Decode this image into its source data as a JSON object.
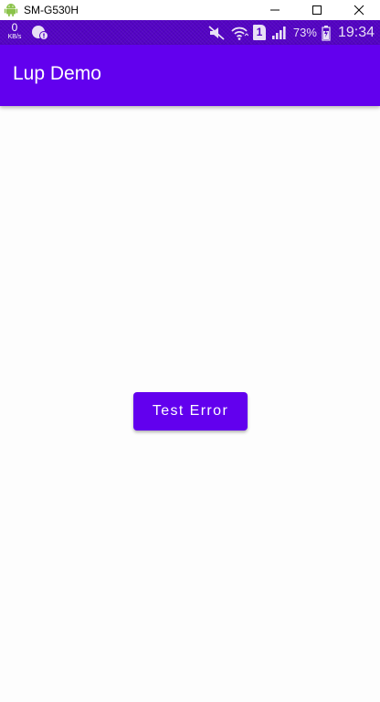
{
  "window": {
    "title": "SM-G530H",
    "controls": [
      "minimize-icon",
      "maximize-icon",
      "close-icon"
    ]
  },
  "status_bar": {
    "data_speed_value": "0",
    "data_speed_unit": "KB/s",
    "battery_percent": "73%",
    "sim_slot": "1",
    "time": "19:34",
    "icons": [
      "notification-icon",
      "mute-icon",
      "wifi-icon",
      "sim-icon",
      "signal-icon",
      "battery-icon"
    ]
  },
  "app_bar": {
    "title": "Lup Demo"
  },
  "main": {
    "button_label": "Test Error"
  },
  "colors": {
    "primary": "#6200ee",
    "status_bar": "#5403c4",
    "background": "#fdfdfd",
    "on_primary": "#ffffff"
  }
}
